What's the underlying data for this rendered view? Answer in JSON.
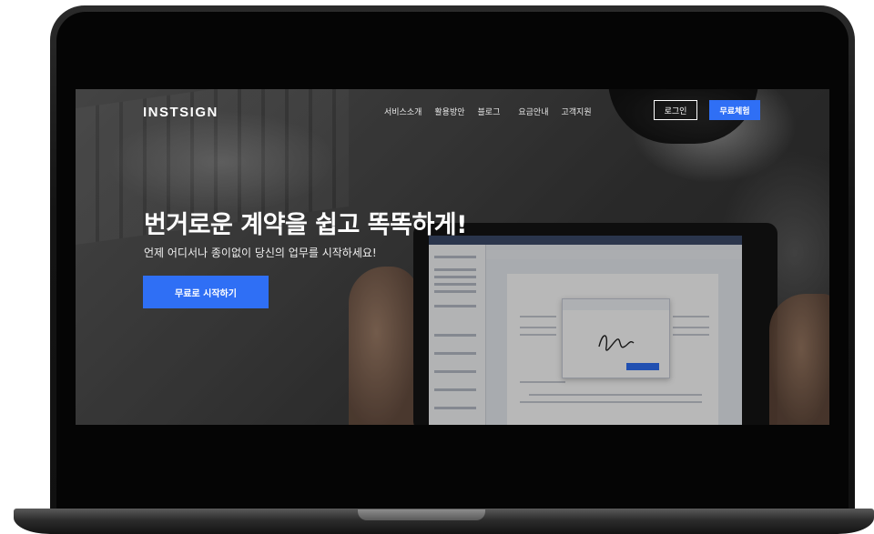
{
  "header": {
    "logo": "INSTSIGN",
    "nav": [
      "서비스소개",
      "활용방안",
      "블로그",
      "요금안내",
      "고객지원"
    ],
    "login_label": "로그인",
    "trial_label": "무료체험"
  },
  "hero": {
    "headline": "번거로운 계약을 쉽고 똑똑하게!",
    "subheadline": "언제 어디서나 종이없이 당신의 업무를 시작하세요!",
    "cta_label": "무료로 시작하기"
  },
  "colors": {
    "accent": "#2f6ff5"
  }
}
